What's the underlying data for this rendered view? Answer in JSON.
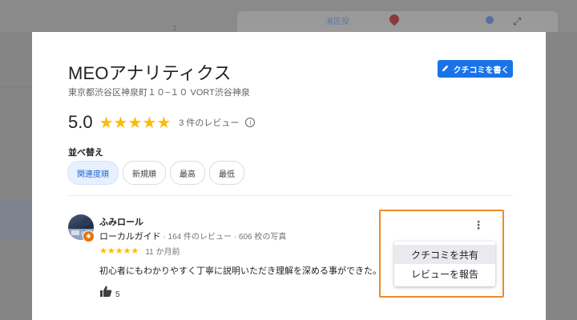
{
  "background": {
    "map_label": "滝区役",
    "menu_dots": "⋮"
  },
  "business": {
    "name": "MEOアナリティクス",
    "address": "東京都渋谷区神泉町１０−１０ VORT渋谷神泉"
  },
  "write_review_button": {
    "label": "クチコミを書く",
    "icon": "pencil-icon"
  },
  "rating": {
    "score": "5.0",
    "stars": "★★★★★",
    "count_text": "3 件のレビュー",
    "info_icon": "i"
  },
  "sort": {
    "label": "並べ替え",
    "chips": [
      {
        "label": "関連度順",
        "active": true
      },
      {
        "label": "新規順",
        "active": false
      },
      {
        "label": "最高",
        "active": false
      },
      {
        "label": "最低",
        "active": false
      }
    ]
  },
  "review": {
    "reviewer_name": "ふみロール",
    "local_guide": "ローカルガイド",
    "meta": " · 164 件のレビュー · 606 枚の写真",
    "stars": "★★★★★",
    "date": "11 か月前",
    "text": "初心者にもわかりやすく丁寧に説明いただき理解を深める事ができた。",
    "likes": "5",
    "more_icon": "⋮"
  },
  "menu": {
    "items": [
      {
        "label": "クチコミを共有"
      },
      {
        "label": "レビューを報告"
      }
    ]
  },
  "colors": {
    "accent": "#1a73e8",
    "star": "#fbbc04",
    "highlight": "#f08a24"
  }
}
